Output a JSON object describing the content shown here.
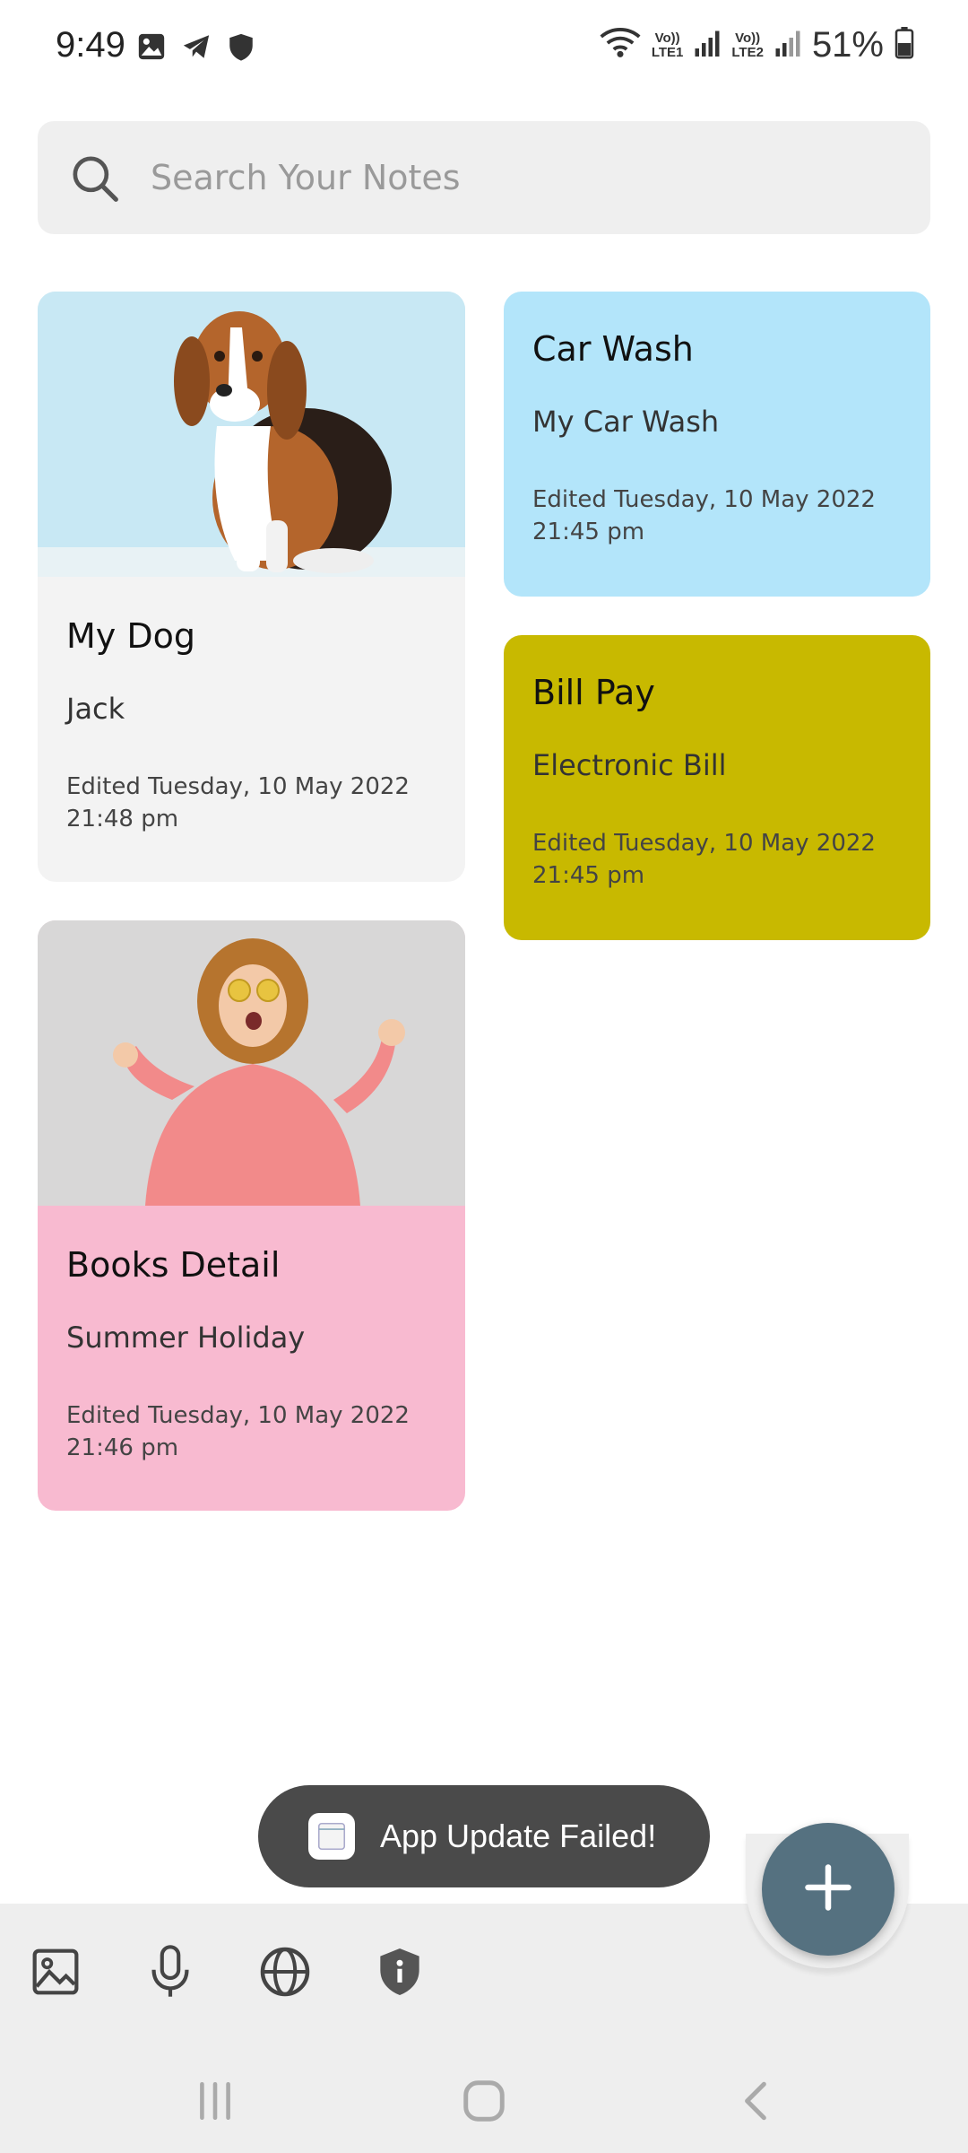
{
  "status_bar": {
    "time": "9:49",
    "battery": "51%",
    "sim1": "Vo))\nLTE1",
    "sim2": "Vo))\nLTE2"
  },
  "search": {
    "placeholder": "Search Your Notes",
    "icon": "search-icon"
  },
  "notes": [
    {
      "title": "My Dog",
      "subtitle": "Jack",
      "edited": "Edited Tuesday, 10 May 2022",
      "time": "21:48 pm",
      "image": "beagle-photo",
      "color": "#f3f3f3"
    },
    {
      "title": "Car Wash",
      "subtitle": "My Car Wash",
      "edited": "Edited Tuesday, 10 May 2022",
      "time": "21:45 pm",
      "color": "#b3e5fa"
    },
    {
      "title": "Bill Pay",
      "subtitle": "Electronic Bill",
      "edited": "Edited Tuesday, 10 May 2022",
      "time": "21:45 pm",
      "color": "#c8b900"
    },
    {
      "title": "Books Detail",
      "subtitle": "Summer Holiday",
      "edited": "Edited Tuesday, 10 May 2022",
      "time": "21:46 pm",
      "image": "woman-pink-hoodie-photo",
      "color": "#f8bad0"
    }
  ],
  "toast": {
    "text": "App Update Failed!"
  },
  "toolbar": {
    "icons": [
      "image-icon",
      "microphone-icon",
      "globe-icon",
      "shield-info-icon"
    ]
  },
  "fab": {
    "icon": "plus-icon",
    "color": "#557180"
  },
  "nav": {
    "icons": [
      "recents-icon",
      "home-icon",
      "back-icon"
    ]
  }
}
